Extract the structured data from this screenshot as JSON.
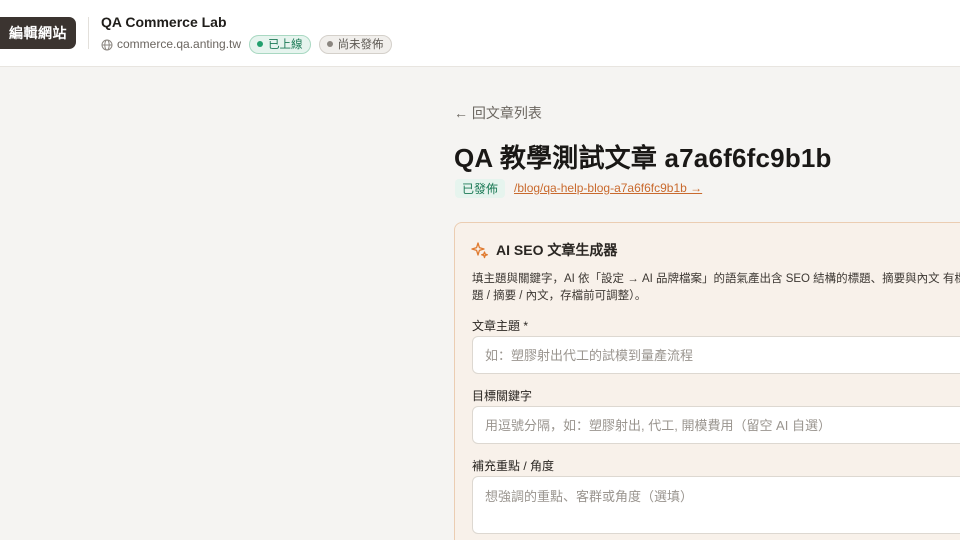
{
  "header": {
    "edit_button": "編輯網站",
    "site_name": "QA Commerce Lab",
    "domain": "commerce.qa.anting.tw",
    "status_online": "已上線",
    "status_unpublished": "尚未發佈",
    "icons": {
      "domain": "globe-icon"
    },
    "colors": {
      "edit_button_bg": "#3b3430",
      "online": "#1c7a56",
      "unpublished": "#5c5852"
    }
  },
  "article": {
    "back_link": "← 回文章列表",
    "title": "QA 教學測試文章 a7a6f6fc9b1b",
    "status": "已發佈",
    "slug_link": "/blog/qa-help-blog-a7a6f6fc9b1b →",
    "colors": {
      "link": "#c96a2e",
      "published": "#1c7a56"
    }
  },
  "seo_generator": {
    "title": "AI SEO 文章生成器",
    "icon": "sparkle-icon",
    "description": "填主題與關鍵字，AI 依「設定 → AI 品牌檔案」的語氣產出含 SEO 結構的標題、摘要與內文 有標題 / 摘要 / 內文，存檔前可調整）。",
    "fields": {
      "topic": {
        "label": "文章主題 *",
        "placeholder": "如：塑膠射出代工的試模到量產流程",
        "value": ""
      },
      "keywords": {
        "label": "目標關鍵字",
        "placeholder": "用逗號分隔，如：塑膠射出, 代工, 開模費用（留空 AI 自選）",
        "value": ""
      },
      "notes": {
        "label": "補充重點 / 角度",
        "placeholder": "想強調的重點、客群或角度（選填）",
        "value": ""
      }
    },
    "colors": {
      "card_bg": "#f8f1ea",
      "card_border": "#ebcdb2",
      "accent": "#e07a2f"
    }
  }
}
